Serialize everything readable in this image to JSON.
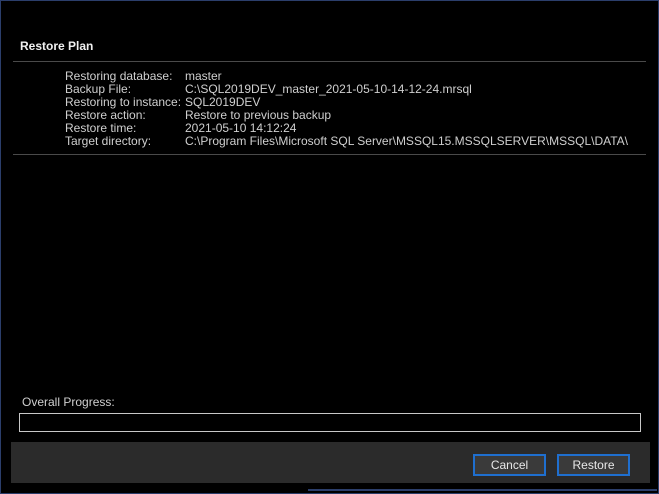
{
  "dialog": {
    "plan_title": "Restore Plan"
  },
  "details": [
    {
      "label": "Restoring database:",
      "value": "master"
    },
    {
      "label": "Backup File:",
      "value": "C:\\SQL2019DEV_master_2021-05-10-14-12-24.mrsql"
    },
    {
      "label": "Restoring to instance:",
      "value": "SQL2019DEV"
    },
    {
      "label": "Restore action:",
      "value": "Restore to previous backup"
    },
    {
      "label": "Restore time:",
      "value": "2021-05-10 14:12:24"
    },
    {
      "label": "Target directory:",
      "value": "C:\\Program Files\\Microsoft SQL Server\\MSSQL15.MSSQLSERVER\\MSSQL\\DATA\\"
    }
  ],
  "progress": {
    "label": "Overall Progress:",
    "fraction": 0
  },
  "buttons": {
    "cancel": "Cancel",
    "restore": "Restore"
  },
  "colors": {
    "accent": "#1f6fcf",
    "background": "#000000",
    "footer": "#2b2b2b"
  }
}
